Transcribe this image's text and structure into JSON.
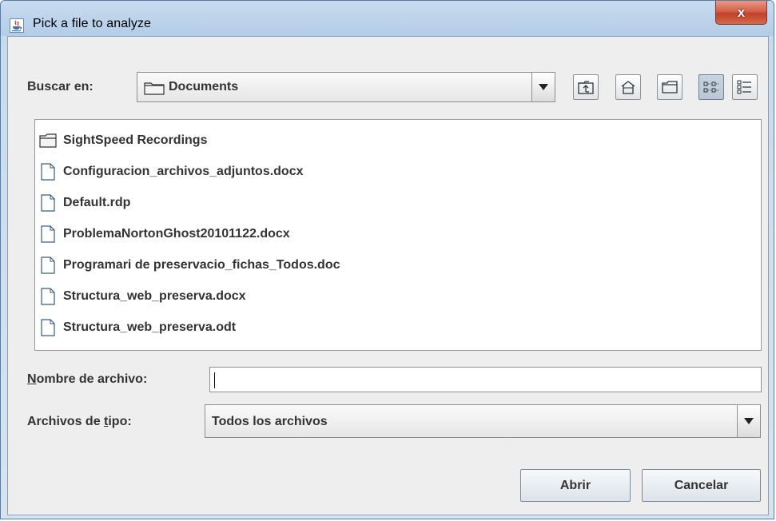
{
  "window": {
    "title": "Pick a file to analyze",
    "close_label": "x"
  },
  "look_in": {
    "label": "Buscar en:",
    "value": "Documents"
  },
  "toolbar": {
    "buttons": [
      "up-folder",
      "home",
      "new-folder",
      "list-view",
      "details-view"
    ],
    "selected": "list-view"
  },
  "files": [
    {
      "name": "SightSpeed Recordings",
      "type": "folder"
    },
    {
      "name": "Configuracion_archivos_adjuntos.docx",
      "type": "file"
    },
    {
      "name": "Default.rdp",
      "type": "file"
    },
    {
      "name": "ProblemaNortonGhost20101122.docx",
      "type": "file"
    },
    {
      "name": "Programari de preservacio_fichas_Todos.doc",
      "type": "file"
    },
    {
      "name": "Structura_web_preserva.docx",
      "type": "file"
    },
    {
      "name": "Structura_web_preserva.odt",
      "type": "file"
    }
  ],
  "filename": {
    "label_first": "N",
    "label_rest": "ombre de archivo:",
    "value": ""
  },
  "filetype": {
    "label_pre": "Archivos de ",
    "label_mnemonic": "t",
    "label_post": "ipo:",
    "value": "Todos los archivos"
  },
  "actions": {
    "open": "Abrir",
    "cancel": "Cancelar"
  }
}
